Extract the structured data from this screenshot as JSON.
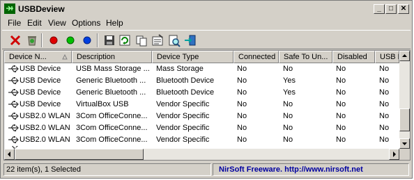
{
  "window": {
    "title": "USBDeview"
  },
  "titlebar_buttons": {
    "minimize": "_",
    "maximize": "□",
    "close": "✕"
  },
  "menu": [
    {
      "label": "File"
    },
    {
      "label": "Edit"
    },
    {
      "label": "View"
    },
    {
      "label": "Options"
    },
    {
      "label": "Help"
    }
  ],
  "toolbar": {
    "buttons": [
      {
        "icon": "disconnect-icon"
      },
      {
        "icon": "uninstall-icon"
      },
      {
        "icon": "red-dot-icon"
      },
      {
        "icon": "green-dot-icon"
      },
      {
        "icon": "blue-dot-icon"
      },
      {
        "icon": "save-icon"
      },
      {
        "icon": "refresh-icon"
      },
      {
        "icon": "copy-icon"
      },
      {
        "icon": "properties-icon"
      },
      {
        "icon": "find-icon"
      },
      {
        "icon": "exit-icon"
      }
    ]
  },
  "columns": [
    "Device N...",
    "Description",
    "Device Type",
    "Connected",
    "Safe To Un...",
    "Disabled",
    "USB H"
  ],
  "rows": [
    [
      "USB Device",
      "USB Mass Storage ...",
      "Mass Storage",
      "No",
      "No",
      "No",
      "No"
    ],
    [
      "USB Device",
      "Generic Bluetooth ...",
      "Bluetooth Device",
      "No",
      "Yes",
      "No",
      "No"
    ],
    [
      "USB Device",
      "Generic Bluetooth ...",
      "Bluetooth Device",
      "No",
      "Yes",
      "No",
      "No"
    ],
    [
      "USB Device",
      "VirtualBox USB",
      "Vendor Specific",
      "No",
      "No",
      "No",
      "No"
    ],
    [
      "USB2.0 WLAN",
      "3Com OfficeConne...",
      "Vendor Specific",
      "No",
      "No",
      "No",
      "No"
    ],
    [
      "USB2.0 WLAN",
      "3Com OfficeConne...",
      "Vendor Specific",
      "No",
      "No",
      "No",
      "No"
    ],
    [
      "USB2.0 WLAN",
      "3Com OfficeConne...",
      "Vendor Specific",
      "No",
      "No",
      "No",
      "No"
    ]
  ],
  "status": {
    "items": "22 item(s), 1 Selected",
    "credit": "NirSoft Freeware.  http://www.nirsoft.net"
  },
  "colors": {
    "face": "#d4d0c8",
    "credit_text": "#0000a0",
    "list_bg": "#ffffff"
  }
}
